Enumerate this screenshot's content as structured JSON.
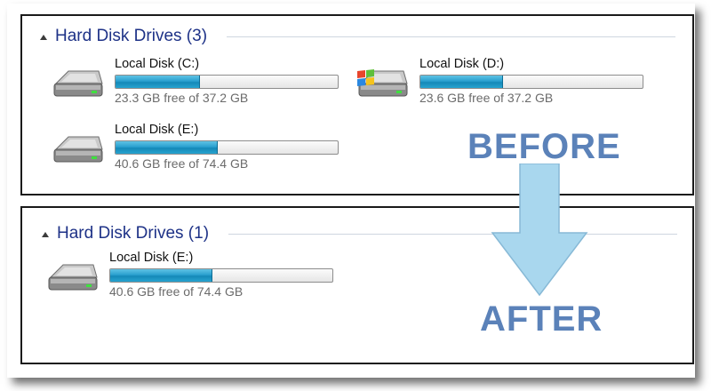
{
  "before": {
    "group_title": "Hard Disk Drives (3)",
    "drives": [
      {
        "name": "Local Disk (C:)",
        "free_text": "23.3 GB free of 37.2 GB",
        "used_fraction": 0.374,
        "icon": "hard-drive-icon"
      },
      {
        "name": "Local Disk (D:)",
        "free_text": "23.6 GB free of 37.2 GB",
        "used_fraction": 0.366,
        "icon": "windows-system-drive-icon"
      },
      {
        "name": "Local Disk (E:)",
        "free_text": "40.6 GB free of 74.4 GB",
        "used_fraction": 0.454,
        "icon": "hard-drive-icon"
      }
    ]
  },
  "after": {
    "group_title": "Hard Disk Drives (1)",
    "drives": [
      {
        "name": "Local Disk (E:)",
        "free_text": "40.6 GB free of 74.4 GB",
        "used_fraction": 0.454,
        "icon": "hard-drive-icon"
      }
    ]
  },
  "labels": {
    "before": "BEFORE",
    "after": "AFTER"
  },
  "colors": {
    "accent_label": "#5b82b9",
    "arrow_fill": "#a9d7ee",
    "bar_fill": "#2aa0cf",
    "group_title": "#1e3287"
  },
  "icons": {
    "collapse": "collapse-triangle-icon",
    "arrow": "down-arrow-icon"
  }
}
